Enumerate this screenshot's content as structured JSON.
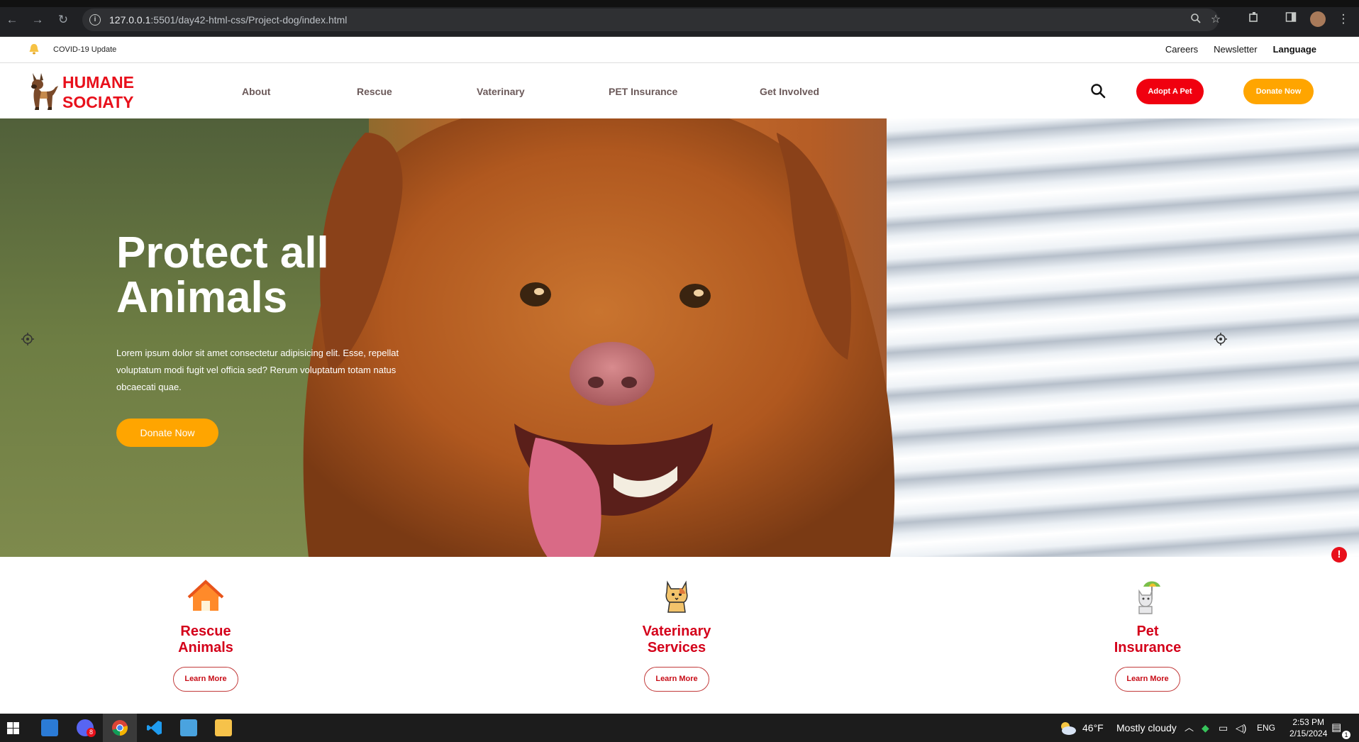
{
  "browser": {
    "url_host": "127.0.0.1",
    "url_path": ":5501/day42-html-css/Project-dog/index.html"
  },
  "topbar": {
    "notice": "COVID-19 Update",
    "links": [
      "Careers",
      "Newsletter",
      "Language"
    ]
  },
  "header": {
    "logo_line1": "HUMANE",
    "logo_line2": "SOCIATY",
    "nav": [
      "About",
      "Rescue",
      "Vaterinary",
      "PET Insurance",
      "Get Involved"
    ],
    "adopt_label": "Adopt A Pet",
    "donate_label": "Donate Now"
  },
  "hero": {
    "title_line1": "Protect all",
    "title_line2": "Animals",
    "lead": "Lorem ipsum dolor sit amet consectetur adipisicing elit. Esse, repellat voluptatum modi fugit vel officia sed? Rerum voluptatum totam natus obcaecati quae.",
    "cta": "Donate Now"
  },
  "services": [
    {
      "title_line1": "Rescue",
      "title_line2": "Animals",
      "button": "Learn More",
      "icon": "house-icon"
    },
    {
      "title_line1": "Vaterinary",
      "title_line2": "Services",
      "button": "Learn More",
      "icon": "cat-icon"
    },
    {
      "title_line1": "Pet",
      "title_line2": "Insurance",
      "button": "Learn More",
      "icon": "umbrella-cat-icon"
    }
  ],
  "taskbar": {
    "weather_temp": "46°F",
    "weather_text": "Mostly cloudy",
    "lang": "ENG",
    "time": "2:53 PM",
    "date": "2/15/2024",
    "discord_badge": "8",
    "notif_count": "1"
  },
  "colors": {
    "brand_red": "#e8101b",
    "accent_orange": "#ffa500"
  }
}
